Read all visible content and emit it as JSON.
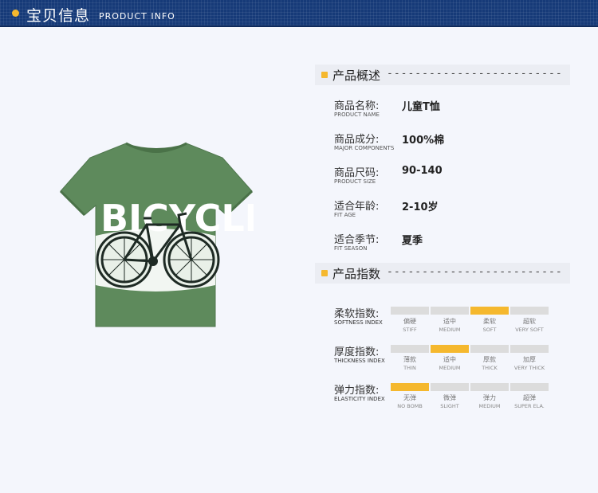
{
  "header": {
    "title": "宝贝信息",
    "subtitle": "PRODUCT INFO"
  },
  "product_image": {
    "description_icon": "t-shirt-bicycle-print",
    "shirt_color": "#5e8a5c",
    "print_text": "BICYCLE"
  },
  "overview": {
    "title": "产品概述",
    "dashes": "-------------------------",
    "rows": [
      {
        "label": "商品名称:",
        "label_en": "PRODUCT NAME",
        "value": "儿童T恤"
      },
      {
        "label": "商品成分:",
        "label_en": "MAJOR COMPONENTS",
        "value": "100%棉"
      },
      {
        "label": "商品尺码:",
        "label_en": "PRODUCT SIZE",
        "value": "90-140"
      },
      {
        "label": "适合年龄:",
        "label_en": "FIT AGE",
        "value": "2-10岁"
      },
      {
        "label": "适合季节:",
        "label_en": "FIT SEASON",
        "value": "夏季"
      }
    ]
  },
  "index": {
    "title": "产品指数",
    "dashes": "-------------------------",
    "rows": [
      {
        "label": "柔软指数:",
        "label_en": "SOFTNESS INDEX",
        "selected": 2,
        "options": [
          {
            "cn": "偏硬",
            "en": "STIFF"
          },
          {
            "cn": "适中",
            "en": "MEDIUM"
          },
          {
            "cn": "柔软",
            "en": "SOFT"
          },
          {
            "cn": "超软",
            "en": "VERY SOFT"
          }
        ]
      },
      {
        "label": "厚度指数:",
        "label_en": "THICKNESS INDEX",
        "selected": 1,
        "options": [
          {
            "cn": "薄款",
            "en": "THIN"
          },
          {
            "cn": "适中",
            "en": "MEDIUM"
          },
          {
            "cn": "厚款",
            "en": "THICK"
          },
          {
            "cn": "加厚",
            "en": "VERY THICK"
          }
        ]
      },
      {
        "label": "弹力指数:",
        "label_en": "ELASTICITY INDEX",
        "selected": 0,
        "options": [
          {
            "cn": "无弹",
            "en": "NO BOMB"
          },
          {
            "cn": "微弹",
            "en": "SLIGHT"
          },
          {
            "cn": "弹力",
            "en": "MEDIUM"
          },
          {
            "cn": "超弹",
            "en": "SUPER ELA."
          }
        ]
      }
    ]
  },
  "colors": {
    "header_bg": "#163a78",
    "accent": "#f5b82e",
    "bar_off": "#dcdcdc"
  }
}
